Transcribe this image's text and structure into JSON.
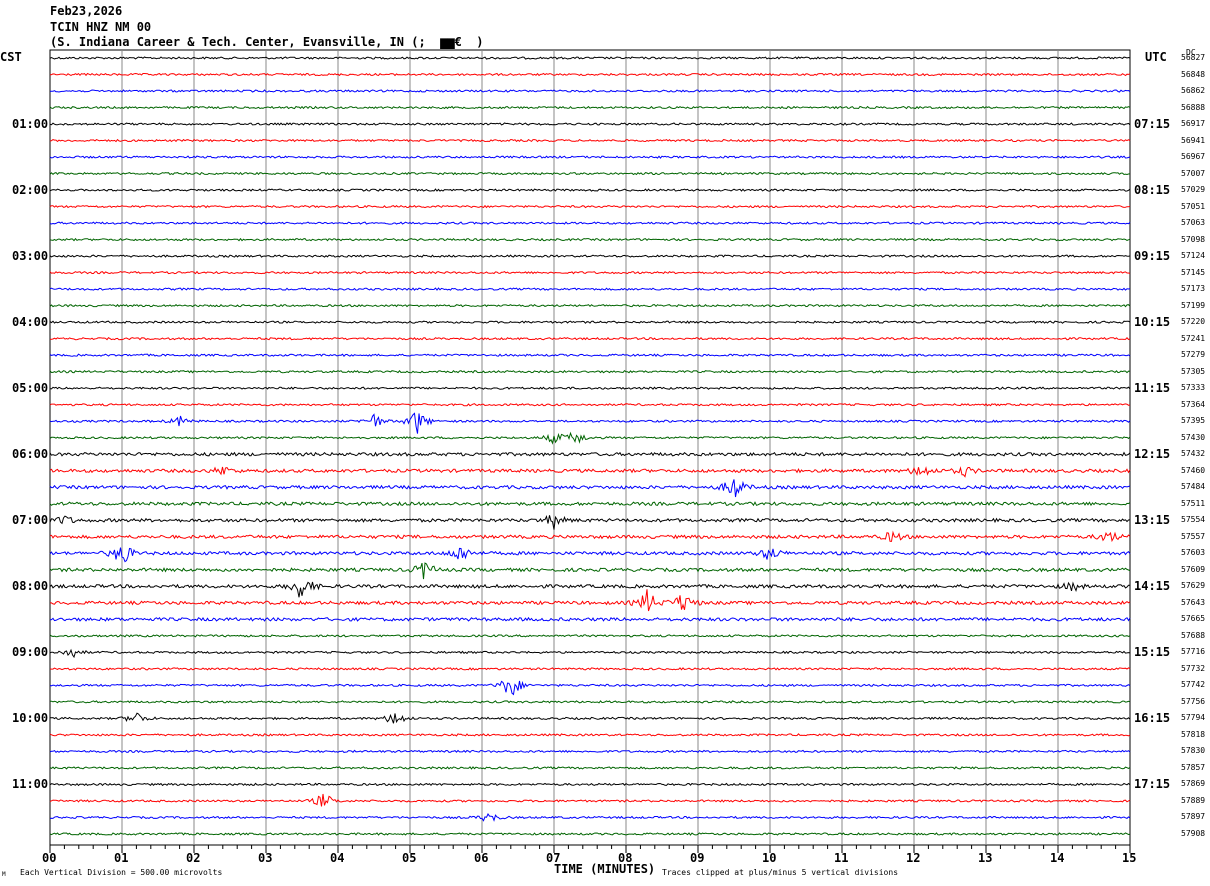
{
  "header": {
    "date": "Feb23,2026",
    "station": "TCIN HNZ NM 00",
    "location": "(S. Indiana Career & Tech. Center, Evansville, IN (;  ▆▆€  )"
  },
  "left_timezone": "CST",
  "right_timezone": "UTC",
  "dc_label": "DC",
  "footer": {
    "vertical_division": "Each Vertical Division =  500.00 microvolts",
    "clip_note": "Traces clipped at plus/minus 5 vertical divisions",
    "corner_mark": "M"
  },
  "chart_data": {
    "type": "line",
    "title": "TCIN HNZ NM 00 helicorder",
    "xlabel": "TIME (MINUTES)",
    "xlim": [
      0,
      15
    ],
    "x_ticks": [
      "00",
      "01",
      "02",
      "03",
      "04",
      "05",
      "06",
      "07",
      "08",
      "09",
      "10",
      "11",
      "12",
      "13",
      "14",
      "15"
    ],
    "left_hour_labels": [
      "01:00",
      "02:00",
      "03:00",
      "04:00",
      "05:00",
      "06:00",
      "07:00",
      "08:00",
      "09:00",
      "10:00",
      "11:00"
    ],
    "right_hour_labels": [
      "07:15",
      "08:15",
      "09:15",
      "10:15",
      "11:15",
      "12:15",
      "13:15",
      "14:15",
      "15:15",
      "16:15",
      "17:15"
    ],
    "trace_colors": [
      "#000000",
      "#ff0000",
      "#0000ff",
      "#006400"
    ],
    "dc_values": [
      "56827",
      "56848",
      "56862",
      "56888",
      "56917",
      "56941",
      "56967",
      "57007",
      "57029",
      "57051",
      "57063",
      "57098",
      "57124",
      "57145",
      "57173",
      "57199",
      "57220",
      "57241",
      "57279",
      "57305",
      "57333",
      "57364",
      "57395",
      "57430",
      "57432",
      "57460",
      "57484",
      "57511",
      "57554",
      "57557",
      "57603",
      "57609",
      "57629",
      "57643",
      "57665",
      "57688",
      "57716",
      "57732",
      "57742",
      "57756",
      "57794",
      "57818",
      "57830",
      "57857",
      "57869",
      "57889",
      "57897",
      "57908"
    ],
    "events": [
      {
        "trace": 22,
        "minute": 1.8,
        "amp": 5
      },
      {
        "trace": 22,
        "minute": 4.5,
        "amp": 8
      },
      {
        "trace": 22,
        "minute": 5.1,
        "amp": 14
      },
      {
        "trace": 23,
        "minute": 7.0,
        "amp": 6
      },
      {
        "trace": 23,
        "minute": 7.3,
        "amp": 8
      },
      {
        "trace": 25,
        "minute": 2.4,
        "amp": 5
      },
      {
        "trace": 25,
        "minute": 12.1,
        "amp": 8
      },
      {
        "trace": 25,
        "minute": 12.7,
        "amp": 5
      },
      {
        "trace": 26,
        "minute": 9.5,
        "amp": 14
      },
      {
        "trace": 28,
        "minute": 0.2,
        "amp": 5
      },
      {
        "trace": 28,
        "minute": 7.0,
        "amp": 8
      },
      {
        "trace": 29,
        "minute": 11.7,
        "amp": 6
      },
      {
        "trace": 29,
        "minute": 14.7,
        "amp": 7
      },
      {
        "trace": 30,
        "minute": 1.0,
        "amp": 14
      },
      {
        "trace": 30,
        "minute": 5.7,
        "amp": 10
      },
      {
        "trace": 30,
        "minute": 10.0,
        "amp": 8
      },
      {
        "trace": 31,
        "minute": 5.2,
        "amp": 10
      },
      {
        "trace": 32,
        "minute": 3.5,
        "amp": 16
      },
      {
        "trace": 32,
        "minute": 14.2,
        "amp": 5
      },
      {
        "trace": 33,
        "minute": 8.3,
        "amp": 14
      },
      {
        "trace": 33,
        "minute": 8.8,
        "amp": 12
      },
      {
        "trace": 36,
        "minute": 0.3,
        "amp": 6
      },
      {
        "trace": 38,
        "minute": 6.4,
        "amp": 16
      },
      {
        "trace": 40,
        "minute": 1.2,
        "amp": 7
      },
      {
        "trace": 40,
        "minute": 4.8,
        "amp": 9
      },
      {
        "trace": 45,
        "minute": 3.8,
        "amp": 9
      },
      {
        "trace": 46,
        "minute": 6.1,
        "amp": 6
      }
    ]
  }
}
